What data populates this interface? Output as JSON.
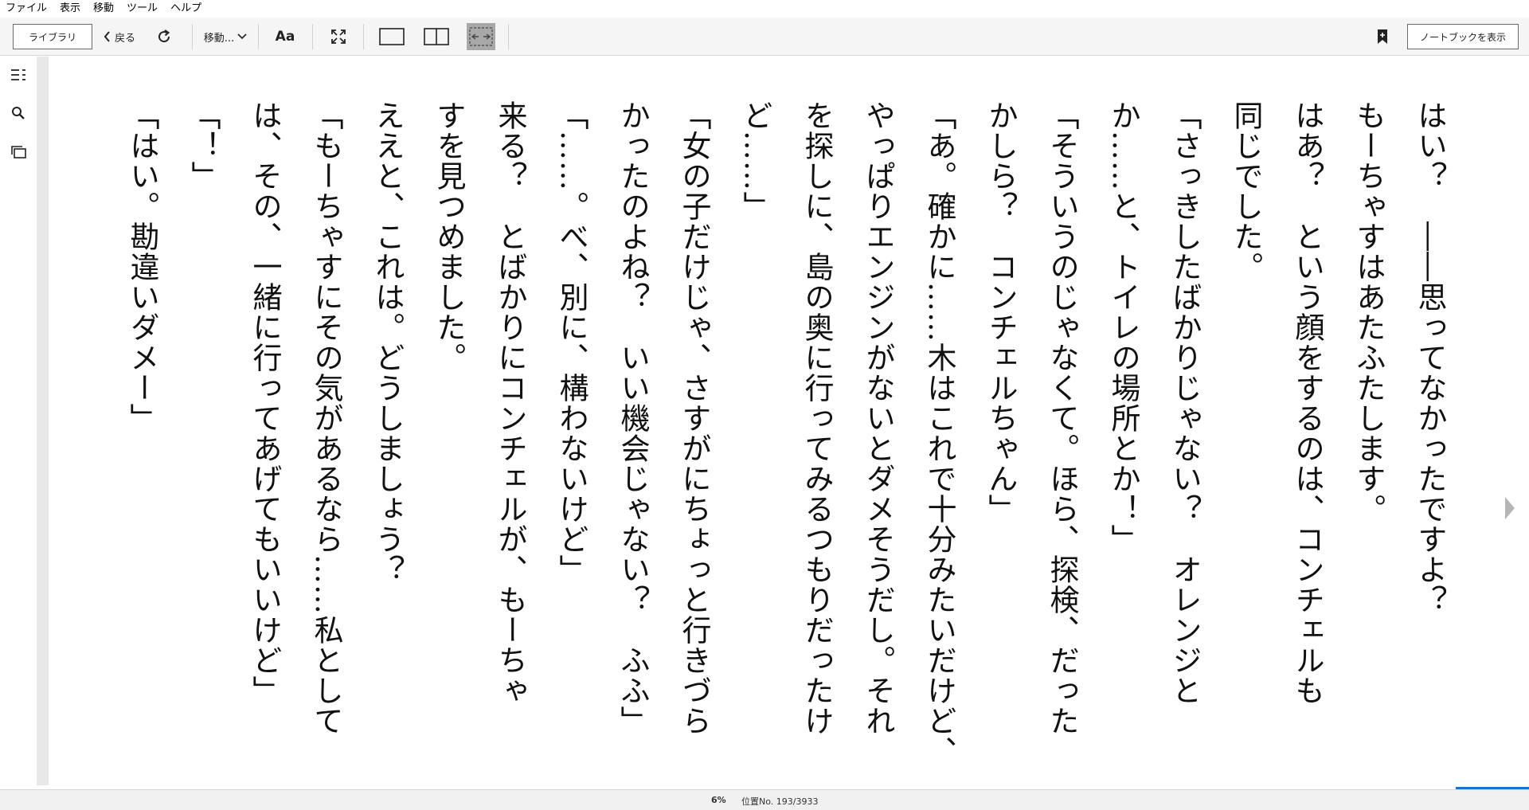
{
  "menubar": {
    "items": [
      "ファイル",
      "表示",
      "移動",
      "ツール",
      "ヘルプ"
    ]
  },
  "toolbar": {
    "library_label": "ライブラリ",
    "back_label": "戻る",
    "goto_label": "移動...",
    "font_label": "Aa",
    "notebook_label": "ノートブックを表示"
  },
  "content": {
    "lines": [
      "はい？　――思ってなかったですよ？",
      "もーちゃすはあたふたします。",
      "はあ？　という顔をするのは、コンチェルも",
      "同じでした。",
      "「さっきしたばかりじゃない？　オレンジと",
      "か……と、トイレの場所とか！」",
      "「そういうのじゃなくて。ほら、探検、だった",
      "かしら？　コンチェルちゃん」",
      "「あ。確かに……木はこれで十分みたいだけど、",
      "やっぱりエンジンがないとダメそうだし。それ",
      "を探しに、島の奥に行ってみるつもりだったけ",
      "ど……」",
      "「女の子だけじゃ、さすがにちょっと行きづら",
      "かったのよね？　いい機会じゃない？　ふふ」",
      "「……。べ、別に、構わないけど」",
      "来る？　とばかりにコンチェルが、もーちゃ",
      "すを見つめました。",
      "ええと、これは。どうしましょう？",
      "「もーちゃすにその気があるなら……私として",
      "は、その、一緒に行ってあげてもいいけど」",
      "「！」",
      "「はい。勘違いダメー」"
    ]
  },
  "status": {
    "percent": "6%",
    "location": "位置No. 193/3933",
    "progress_fraction": 0.06
  },
  "colors": {
    "progress": "#1a75c9",
    "active_view": "#a8a8a8"
  },
  "icons": {
    "sidebar": [
      "toc-icon",
      "search-icon",
      "flashcards-icon"
    ],
    "toolbar": [
      "chevron-left-icon",
      "sync-icon",
      "chevron-down-icon",
      "fullscreen-icon",
      "single-page-icon",
      "two-page-icon",
      "fit-width-icon",
      "bookmark-icon"
    ]
  }
}
